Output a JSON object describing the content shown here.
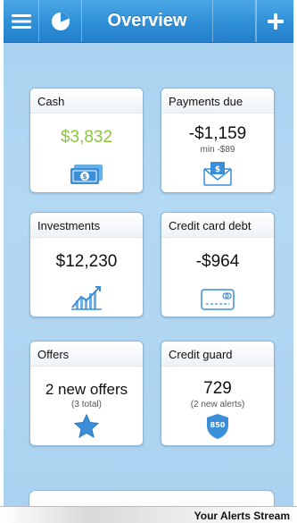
{
  "header": {
    "title": "Overview"
  },
  "cards": {
    "cash": {
      "title": "Cash",
      "value": "$3,832"
    },
    "payments": {
      "title": "Payments due",
      "value": "-$1,159",
      "sub": "min -$89"
    },
    "investments": {
      "title": "Investments",
      "value": "$12,230"
    },
    "credit_card": {
      "title": "Credit card debt",
      "value": "-$964"
    },
    "offers": {
      "title": "Offers",
      "value": "2 new offers",
      "sub": "(3 total)"
    },
    "credit_guard": {
      "title": "Credit guard",
      "value": "729",
      "sub": "(2 new alerts)",
      "badge": "850"
    }
  },
  "footer": {
    "stream_label": "Your Alerts Stream"
  },
  "colors": {
    "accent": "#2f8fd6",
    "positive": "#8cc63f",
    "icon": "#3a8fd8"
  },
  "icons": [
    "menu-icon",
    "pie-chart-icon",
    "plus-icon",
    "cash-icon",
    "envelope-dollar-icon",
    "chart-icon",
    "credit-card-icon",
    "star-icon",
    "shield-icon"
  ]
}
